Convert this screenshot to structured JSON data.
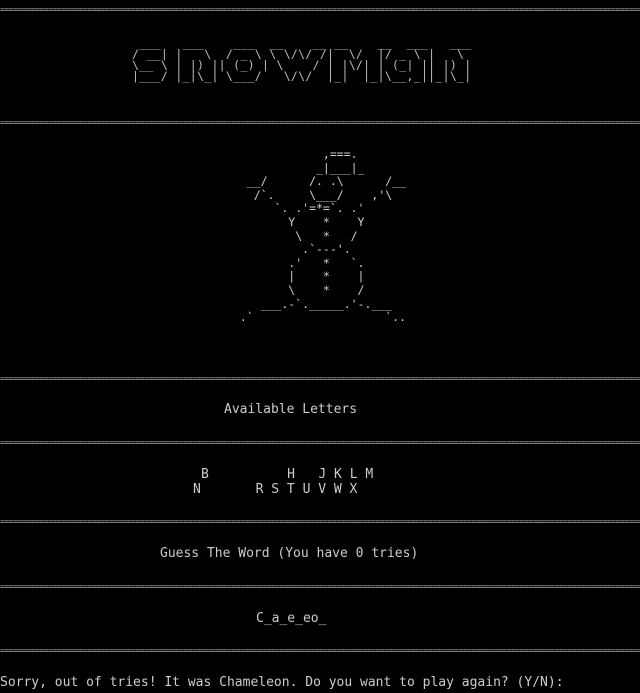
{
  "banner_art": " ___   ___    ___  __    __ __    __  ___   ___\n/ __| |   \\  / _ \\ \\ \\/\\/ /|  \\/  |/ _ \\ |   \\\n\\__ \\ | |) || (_) | \\    / | |\\/| | (_| || |) |\n|___/ |_|\\_| \\___/   \\/\\/  |_|  |_|\\__,_||_|\\_|",
  "snowman_art": "              ,===.\n             _|___|_\n   __/      /. .\\      /__\n    /`.     \\___/    ,'\\\n       `. .'=*=`. .'\n         Y    *    Y\n          \\   *   /\n           .`---'.\n         .'   *   `.\n         |    *    |\n         \\    *    /\n     ___.-`._____.'-.___\n  .`                   `..",
  "sections": {
    "available_letters_title": "Available Letters",
    "letters_row_1": "B          H   J K L M",
    "letters_row_2": "N       R S T U V W X",
    "guess_title": "Guess The Word (You have 0 tries)",
    "word_progress": "C_a_e_eo_"
  },
  "prompt": {
    "message": "Sorry, out of tries! It was Chameleon. Do you want to play again? (Y/N):"
  },
  "colors": {
    "background": "#000000",
    "text": "#cccccc"
  }
}
